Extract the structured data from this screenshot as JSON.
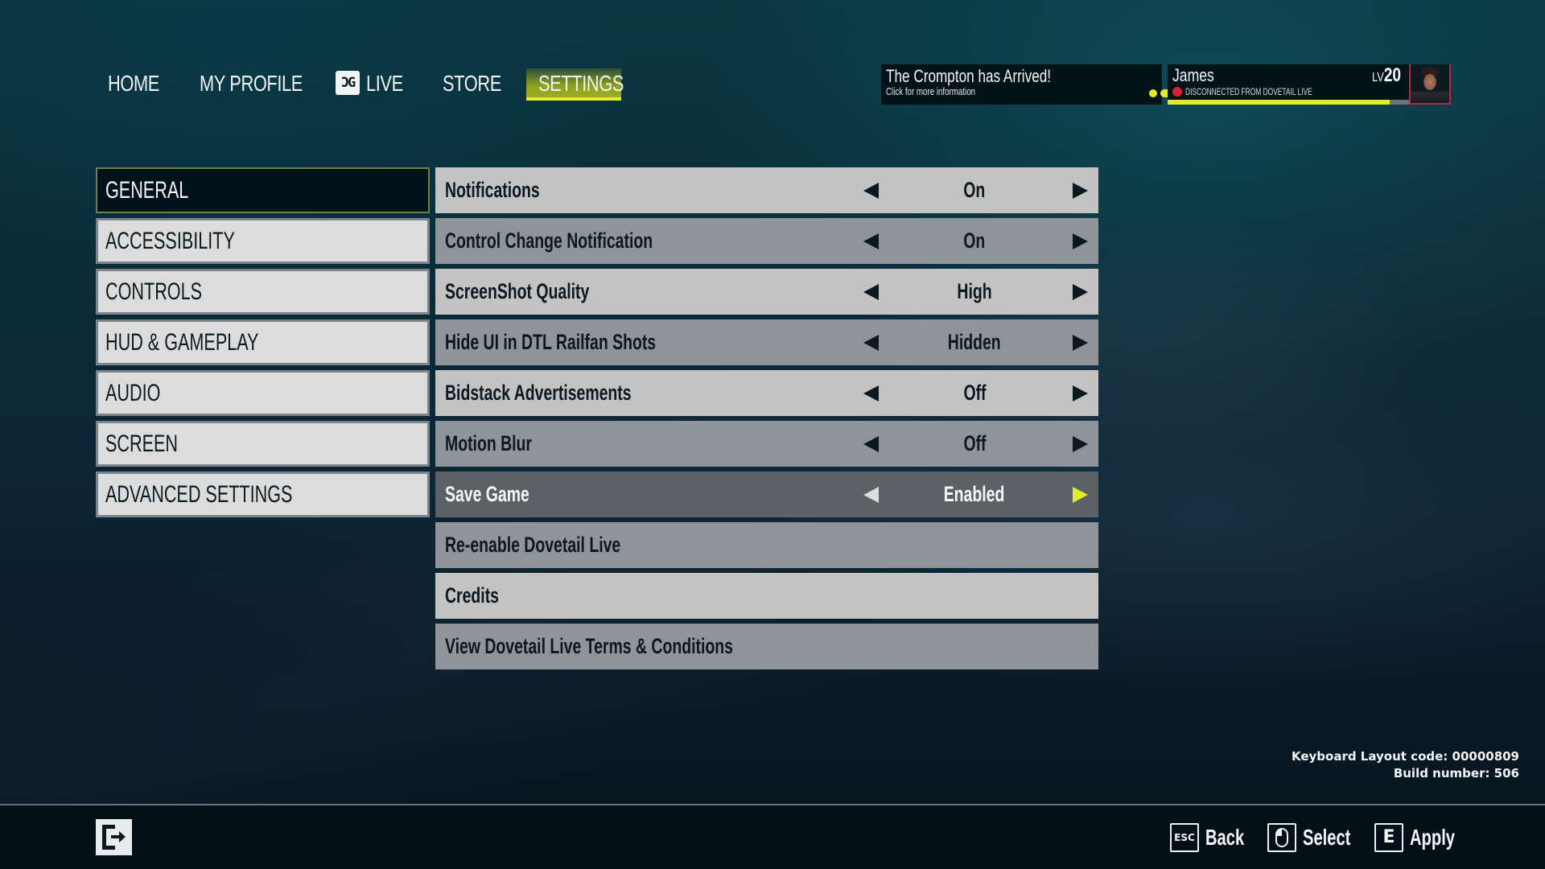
{
  "nav": {
    "items": [
      {
        "label": "HOME",
        "active": false
      },
      {
        "label": "MY PROFILE",
        "active": false
      },
      {
        "label": "LIVE",
        "icon": "dovetail-live-logo-icon",
        "icon_text": "ƆG",
        "active": false
      },
      {
        "label": "STORE",
        "active": false
      },
      {
        "label": "SETTINGS",
        "active": true
      }
    ]
  },
  "notification": {
    "title": "The Crompton has Arrived!",
    "subtitle": "Click for more information",
    "pager_dots": 3,
    "active_dot": 2
  },
  "user": {
    "name": "James",
    "status": "DISCONNECTED FROM DOVETAIL LIVE",
    "status_color": "#d8203a",
    "level_prefix": "LV",
    "level": "20",
    "xp_progress": 0.92
  },
  "sidebar": {
    "items": [
      {
        "label": "GENERAL",
        "active": true
      },
      {
        "label": "ACCESSIBILITY",
        "active": false
      },
      {
        "label": "CONTROLS",
        "active": false
      },
      {
        "label": "HUD & GAMEPLAY",
        "active": false
      },
      {
        "label": "AUDIO",
        "active": false
      },
      {
        "label": "SCREEN",
        "active": false
      },
      {
        "label": "ADVANCED SETTINGS",
        "active": false
      }
    ]
  },
  "settings": {
    "rows": [
      {
        "label": "Notifications",
        "value": "On",
        "type": "selector"
      },
      {
        "label": "Control Change Notification",
        "value": "On",
        "type": "selector"
      },
      {
        "label": "ScreenShot Quality",
        "value": "High",
        "type": "selector"
      },
      {
        "label": "Hide UI in DTL Railfan Shots",
        "value": "Hidden",
        "type": "selector"
      },
      {
        "label": "Bidstack Advertisements",
        "value": "Off",
        "type": "selector"
      },
      {
        "label": "Motion Blur",
        "value": "Off",
        "type": "selector"
      },
      {
        "label": "Save Game",
        "value": "Enabled",
        "type": "selector",
        "selected": true
      },
      {
        "label": "Re-enable Dovetail Live",
        "type": "button"
      },
      {
        "label": "Credits",
        "type": "button"
      },
      {
        "label": "View Dovetail Live Terms & Conditions",
        "type": "button"
      }
    ]
  },
  "info": {
    "keyboard_layout": "Keyboard Layout code: 00000809",
    "build_number": "Build number: 506"
  },
  "footer": {
    "exit_icon": "exit-icon",
    "hints": [
      {
        "key": "ESC",
        "label": "Back"
      },
      {
        "key": "mouse-left-click-icon",
        "label": "Select"
      },
      {
        "key": "E",
        "label": "Apply"
      }
    ]
  },
  "colors": {
    "accent_yellow": "#e4ea2c",
    "row_light": "#c3c3c3",
    "row_dark": "#8f9499",
    "row_selected": "#5c6166",
    "sidebar_item": "#dcdcdc",
    "sidebar_active": "#02121a"
  }
}
